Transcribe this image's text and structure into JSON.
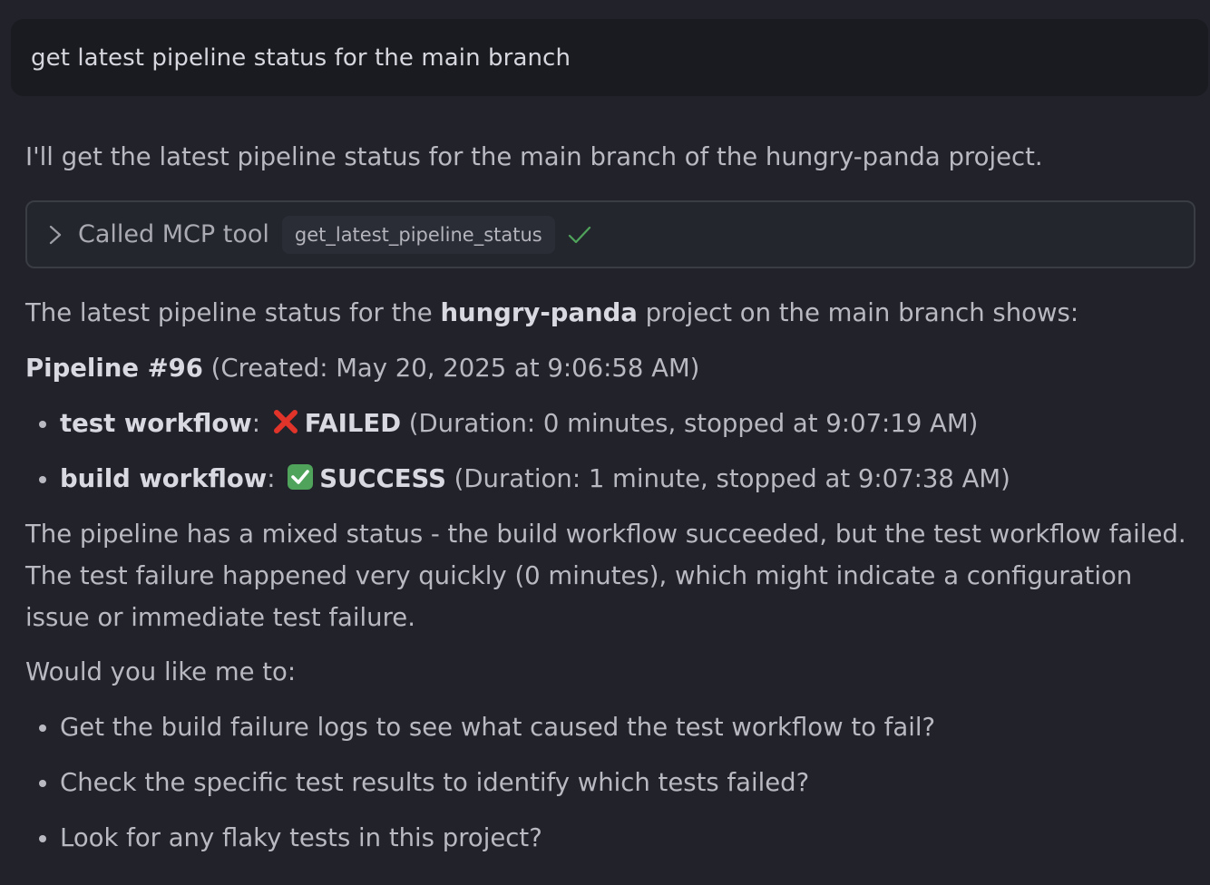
{
  "user_message": "get latest pipeline status for the main branch",
  "reply": {
    "intro": "I'll get the latest pipeline status for the main branch of the hungry-panda project.",
    "tool_call": {
      "label": "Called MCP tool",
      "tool_name": "get_latest_pipeline_status",
      "status_icon": "check-icon"
    },
    "summary_prefix": "The latest pipeline status for the ",
    "summary_project": "hungry-panda",
    "summary_suffix": " project on the main branch shows:",
    "pipeline_title": "Pipeline #96",
    "pipeline_created": " (Created: May 20, 2025 at 9:06:58 AM)",
    "workflows": [
      {
        "name": "test workflow",
        "colon": ":",
        "status_icon": "cross-mark-icon",
        "status": "FAILED",
        "details": " (Duration: 0 minutes, stopped at 9:07:19 AM)"
      },
      {
        "name": "build workflow",
        "colon": ":",
        "status_icon": "check-mark-button-icon",
        "status": "SUCCESS",
        "details": " (Duration: 1 minute, stopped at 9:07:38 AM)"
      }
    ],
    "analysis": "The pipeline has a mixed status - the build workflow succeeded, but the test workflow failed. The test failure happened very quickly (0 minutes), which might indicate a configuration issue or immediate test failure.",
    "question": "Would you like me to:",
    "options": [
      "Get the build failure logs to see what caused the test workflow to fail?",
      "Check the specific test results to identify which tests failed?",
      "Look for any flaky tests in this project?"
    ]
  },
  "colors": {
    "background": "#21222a",
    "user_bubble": "#1a1b20",
    "success_green": "#4fa35b",
    "fail_red": "#e0342b"
  }
}
